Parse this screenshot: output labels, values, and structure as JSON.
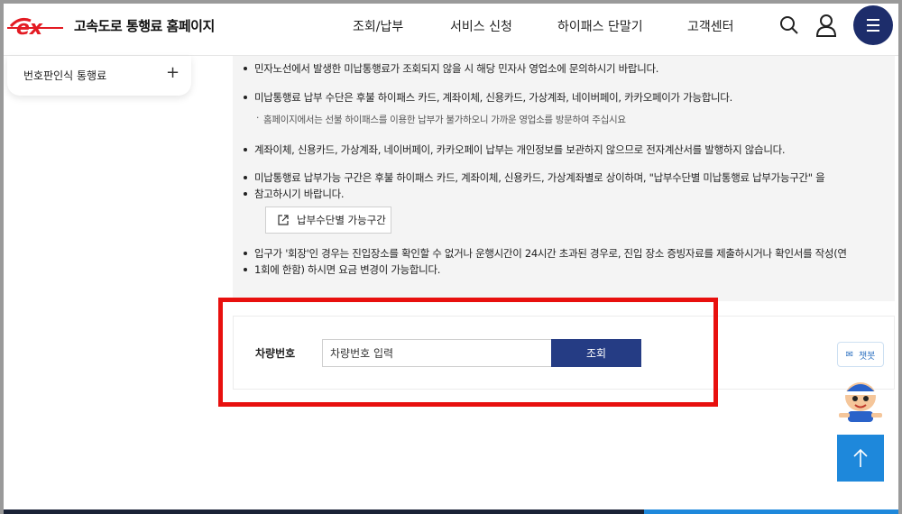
{
  "header": {
    "logo_text": "ex",
    "site_title": "고속도로 통행료 홈페이지",
    "nav": [
      {
        "label": "조회/납부"
      },
      {
        "label": "서비스 신청"
      },
      {
        "label": "하이패스 단말기"
      },
      {
        "label": "고객센터"
      }
    ],
    "icons": [
      "search-icon",
      "user-icon",
      "menu-icon"
    ],
    "brand_color": "#1d2d6b",
    "logo_color": "#e31b23"
  },
  "sidebar": {
    "item_label": "번호판인식 통행료"
  },
  "notice": {
    "bullets": [
      "민자노선에서 발생한 미납통행료가 조회되지 않을 시 해당 민자사 영업소에 문의하시기 바랍니다.",
      "미납통행료 납부 수단은 후불 하이패스 카드, 계좌이체, 신용카드, 가상계좌, 네이버페이, 카카오페이가 가능합니다.",
      "계좌이체, 신용카드, 가상계좌, 네이버페이, 카카오페이 납부는 개인정보를 보관하지 않으므로 전자계산서를 발행하지 않습니다.",
      "미납통행료 납부가능 구간은 후불 하이패스 카드, 계좌이체, 신용카드, 가상계좌별로 상이하며, \"납부수단별 미납통행료 납부가능구간\" 을",
      "참고하시기 바랍니다.",
      "입구가 '회장'인 경우는 진입장소를 확인할 수 없거나 운행시간이 24시간 초과된 경우로, 진입 장소 증빙자료를 제출하시거나 확인서를 작성(연",
      "1회에 한함) 하시면 요금 변경이 가능합니다."
    ],
    "sub_note": "홈페이지에서는 선불 하이패스를 이용한 납부가 불가하오니 가까운 영업소를 방문하여 주십시요",
    "section_button_label": "납부수단별 가능구간"
  },
  "search": {
    "plate_label": "차량번호",
    "plate_placeholder": "차량번호 입력",
    "query_button_label": "조회",
    "button_color": "#253c84",
    "highlight_color": "#e8100e"
  },
  "floating": {
    "chatbot_label": "챗봇",
    "top_button_icon": "arrow-up-icon",
    "top_button_color": "#1e88db"
  }
}
